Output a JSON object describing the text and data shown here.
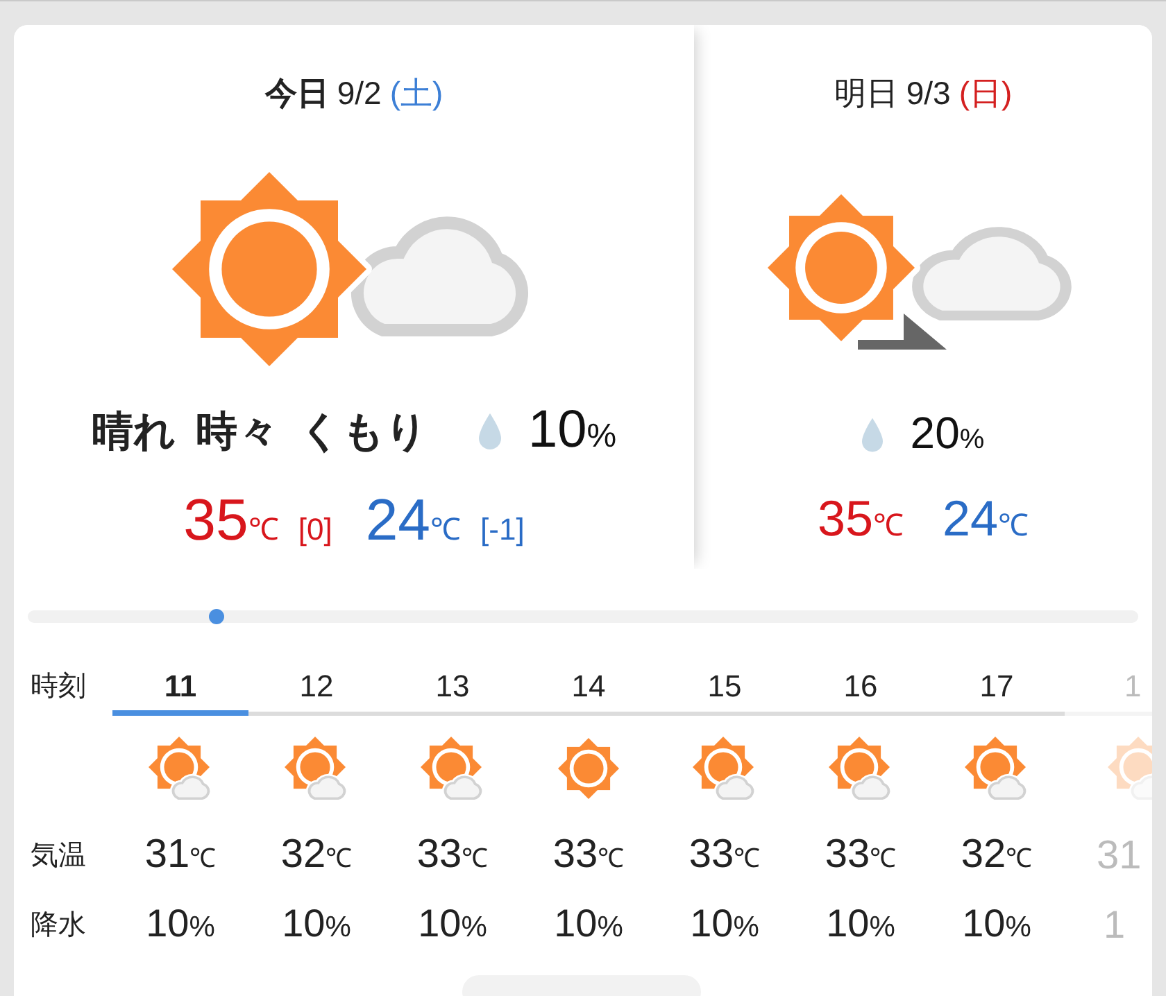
{
  "days": [
    {
      "label": "今日",
      "date": "9/2",
      "weekday": {
        "text": "(土)",
        "color": "#3c7fd6"
      },
      "selected": true,
      "kind": "sometimes",
      "weather": "晴れ 時々 くもり",
      "precip": {
        "value": "10",
        "unit": "%"
      },
      "high": {
        "value": "35",
        "unit": "℃",
        "diff": "[0]"
      },
      "low": {
        "value": "24",
        "unit": "℃",
        "diff": "[-1]"
      }
    },
    {
      "label": "明日",
      "date": "9/3",
      "weekday": {
        "text": "(日)",
        "color": "#d42020"
      },
      "selected": false,
      "kind": "later",
      "precip": {
        "value": "20",
        "unit": "%"
      },
      "high": {
        "value": "35",
        "unit": "℃"
      },
      "low": {
        "value": "24",
        "unit": "℃"
      }
    }
  ],
  "scroll_slider": {
    "level": 0.17
  },
  "hourly": {
    "row_labels": [
      "時刻",
      "気温",
      "降水"
    ],
    "hours": [
      {
        "time": "11",
        "selected": true,
        "faded": false,
        "kind": "partly",
        "temp": {
          "value": "31",
          "unit": "℃"
        },
        "precip": {
          "value": "10",
          "unit": "%"
        }
      },
      {
        "time": "12",
        "selected": false,
        "faded": false,
        "kind": "partly",
        "temp": {
          "value": "32",
          "unit": "℃"
        },
        "precip": {
          "value": "10",
          "unit": "%"
        }
      },
      {
        "time": "13",
        "selected": false,
        "faded": false,
        "kind": "partly",
        "temp": {
          "value": "33",
          "unit": "℃"
        },
        "precip": {
          "value": "10",
          "unit": "%"
        }
      },
      {
        "time": "14",
        "selected": false,
        "faded": false,
        "kind": "clear",
        "temp": {
          "value": "33",
          "unit": "℃"
        },
        "precip": {
          "value": "10",
          "unit": "%"
        }
      },
      {
        "time": "15",
        "selected": false,
        "faded": false,
        "kind": "partly",
        "temp": {
          "value": "33",
          "unit": "℃"
        },
        "precip": {
          "value": "10",
          "unit": "%"
        }
      },
      {
        "time": "16",
        "selected": false,
        "faded": false,
        "kind": "partly",
        "temp": {
          "value": "33",
          "unit": "℃"
        },
        "precip": {
          "value": "10",
          "unit": "%"
        }
      },
      {
        "time": "17",
        "selected": false,
        "faded": false,
        "kind": "partly",
        "temp": {
          "value": "32",
          "unit": "℃"
        },
        "precip": {
          "value": "10",
          "unit": "%"
        }
      },
      {
        "time": "1",
        "selected": false,
        "faded": true,
        "kind": "partly",
        "temp": {
          "value": "31"
        },
        "precip": {
          "value": "1"
        }
      }
    ]
  }
}
